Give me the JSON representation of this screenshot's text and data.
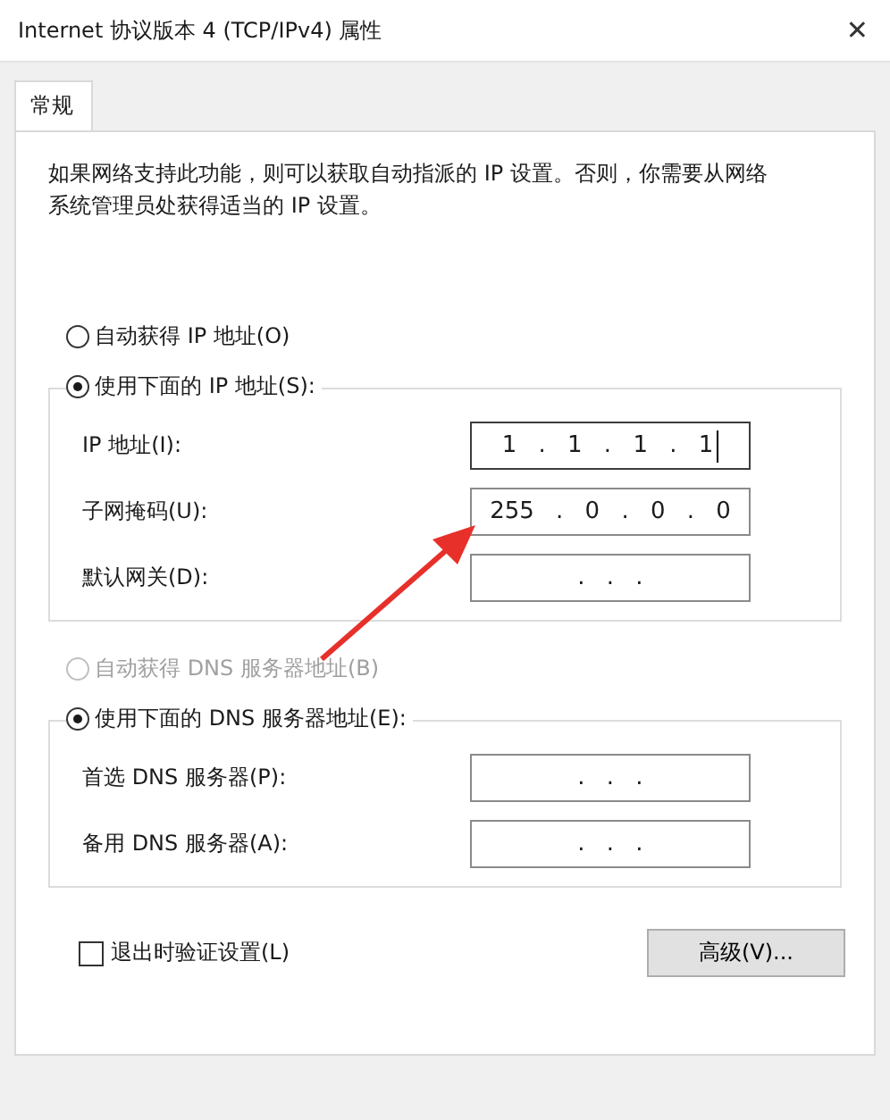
{
  "window": {
    "title": "Internet 协议版本 4 (TCP/IPv4) 属性",
    "close": "✕"
  },
  "tabs": [
    {
      "label": "常规",
      "selected": true
    }
  ],
  "description": "如果网络支持此功能，则可以获取自动指派的 IP 设置。否则，你需要从网络系统管理员处获得适当的 IP 设置。",
  "ip_auto": {
    "label": "自动获得 IP 地址(O)",
    "selected": false,
    "disabled": false
  },
  "ip_manual": {
    "label": "使用下面的 IP 地址(S):",
    "selected": true,
    "disabled": false,
    "fields": [
      {
        "label": "IP 地址(I):",
        "value": "1 . 1 . 1 . 1",
        "focused": true
      },
      {
        "label": "子网掩码(U):",
        "value": "255 . 0 . 0 . 0",
        "focused": false
      },
      {
        "label": "默认网关(D):",
        "value": ". . .",
        "focused": false
      }
    ]
  },
  "dns_auto": {
    "label": "自动获得 DNS 服务器地址(B)",
    "selected": false,
    "disabled": true
  },
  "dns_manual": {
    "label": "使用下面的 DNS 服务器地址(E):",
    "selected": true,
    "disabled": false,
    "fields": [
      {
        "label": "首选 DNS 服务器(P):",
        "value": ". . .",
        "focused": false
      },
      {
        "label": "备用 DNS 服务器(A):",
        "value": ". . .",
        "focused": false
      }
    ]
  },
  "validate": {
    "label": "退出时验证设置(L)",
    "checked": false
  },
  "advanced_button": "高级(V)..."
}
